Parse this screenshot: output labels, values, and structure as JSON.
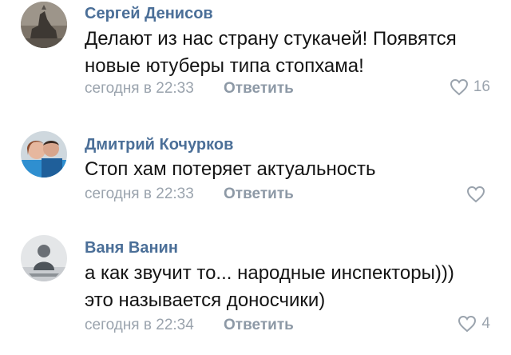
{
  "comments": [
    {
      "author": "Сергей Денисов",
      "lines": [
        "Делают из нас страну стукачей! Появятся",
        "новые ютуберы типа стопхама!"
      ],
      "time": "сегодня в 22:33",
      "reply_label": "Ответить",
      "likes": "16"
    },
    {
      "author": "Дмитрий Кочурков",
      "lines": [
        "Стоп хам потеряет актуальность"
      ],
      "time": "сегодня в 22:33",
      "reply_label": "Ответить",
      "likes": ""
    },
    {
      "author": "Ваня Ванин",
      "lines": [
        "а как звучит то... народные инспекторы)))",
        "это называется доносчики)"
      ],
      "time": "сегодня в 22:34",
      "reply_label": "Ответить",
      "likes": "4"
    }
  ],
  "colors": {
    "author": "#4b6f98",
    "text": "#141414",
    "meta": "#9aa3ad",
    "reply": "#8d99a6",
    "heart": "#9aa3ad"
  },
  "icons": {
    "like": "heart-outline-icon"
  }
}
